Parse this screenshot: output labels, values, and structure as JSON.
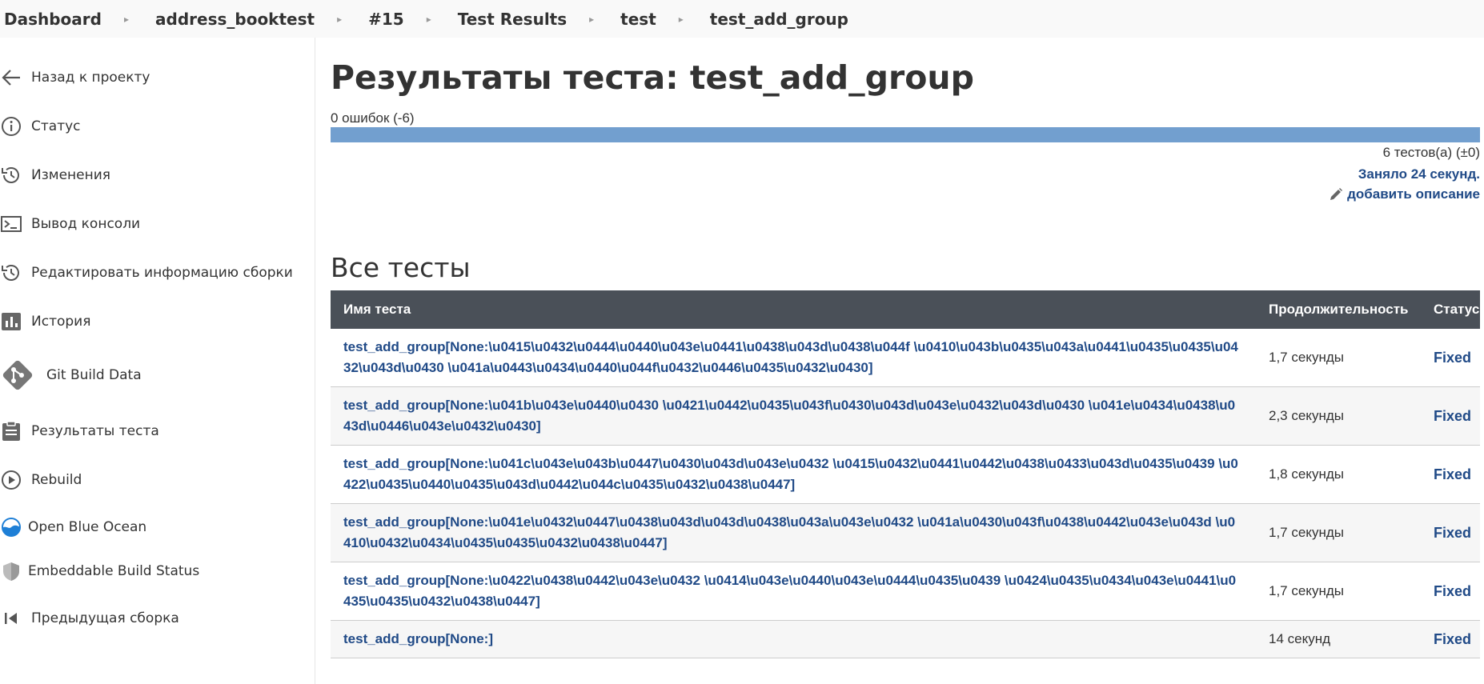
{
  "breadcrumbs": [
    "Dashboard",
    "address_booktest",
    "#15",
    "Test Results",
    "test",
    "test_add_group"
  ],
  "sidebar": {
    "items": [
      {
        "label": "Назад к проекту",
        "icon": "arrow-left-icon"
      },
      {
        "label": "Статус",
        "icon": "info-icon"
      },
      {
        "label": "Изменения",
        "icon": "history-icon"
      },
      {
        "label": "Вывод консоли",
        "icon": "terminal-icon"
      },
      {
        "label": "Редактировать информацию сборки",
        "icon": "history-icon"
      },
      {
        "label": "История",
        "icon": "bar-chart-icon"
      },
      {
        "label": "Git Build Data",
        "icon": "git-icon"
      },
      {
        "label": "Результаты теста",
        "icon": "clipboard-icon"
      },
      {
        "label": "Rebuild",
        "icon": "play-circle-icon"
      },
      {
        "label": "Open Blue Ocean",
        "icon": "blue-ocean-icon"
      },
      {
        "label": "Embeddable Build Status",
        "icon": "shield-icon"
      },
      {
        "label": "Предыдущая сборка",
        "icon": "skip-back-icon"
      }
    ]
  },
  "main": {
    "title": "Результаты теста: test_add_group",
    "failures_text": "0 ошибок (-6)",
    "pass_fraction": 1.0,
    "bar_color": "#729fcf",
    "tests_count": "6 тестов(а) (±0)",
    "duration": "Заняло 24 секунд.",
    "add_description": "добавить описание",
    "section_title": "Все тесты",
    "table": {
      "headers": [
        "Имя теста",
        "Продолжительность",
        "Статус"
      ],
      "rows": [
        {
          "name": "test_add_group[None:\\u0415\\u0432\\u0444\\u0440\\u043e\\u0441\\u0438\\u043d\\u0438\\u044f \\u0410\\u043b\\u0435\\u043a\\u0441\\u0435\\u0435\\u0432\\u043d\\u0430 \\u041a\\u0443\\u0434\\u0440\\u044f\\u0432\\u0446\\u0435\\u0432\\u0430]",
          "duration": "1,7 секунды",
          "status": "Fixed"
        },
        {
          "name": "test_add_group[None:\\u041b\\u043e\\u0440\\u0430 \\u0421\\u0442\\u0435\\u043f\\u0430\\u043d\\u043e\\u0432\\u043d\\u0430 \\u041e\\u0434\\u0438\\u043d\\u0446\\u043e\\u0432\\u0430]",
          "duration": "2,3 секунды",
          "status": "Fixed"
        },
        {
          "name": "test_add_group[None:\\u041c\\u043e\\u043b\\u0447\\u0430\\u043d\\u043e\\u0432 \\u0415\\u0432\\u0441\\u0442\\u0438\\u0433\\u043d\\u0435\\u0439 \\u0422\\u0435\\u0440\\u0435\\u043d\\u0442\\u044c\\u0435\\u0432\\u0438\\u0447]",
          "duration": "1,8 секунды",
          "status": "Fixed"
        },
        {
          "name": "test_add_group[None:\\u041e\\u0432\\u0447\\u0438\\u043d\\u043d\\u0438\\u043a\\u043e\\u0432 \\u041a\\u0430\\u043f\\u0438\\u0442\\u043e\\u043d \\u0410\\u0432\\u0434\\u0435\\u0435\\u0432\\u0438\\u0447]",
          "duration": "1,7 секунды",
          "status": "Fixed"
        },
        {
          "name": "test_add_group[None:\\u0422\\u0438\\u0442\\u043e\\u0432 \\u0414\\u043e\\u0440\\u043e\\u0444\\u0435\\u0439 \\u0424\\u0435\\u0434\\u043e\\u0441\\u0435\\u0435\\u0432\\u0438\\u0447]",
          "duration": "1,7 секунды",
          "status": "Fixed"
        },
        {
          "name": "test_add_group[None:]",
          "duration": "14 секунд",
          "status": "Fixed"
        }
      ]
    }
  }
}
